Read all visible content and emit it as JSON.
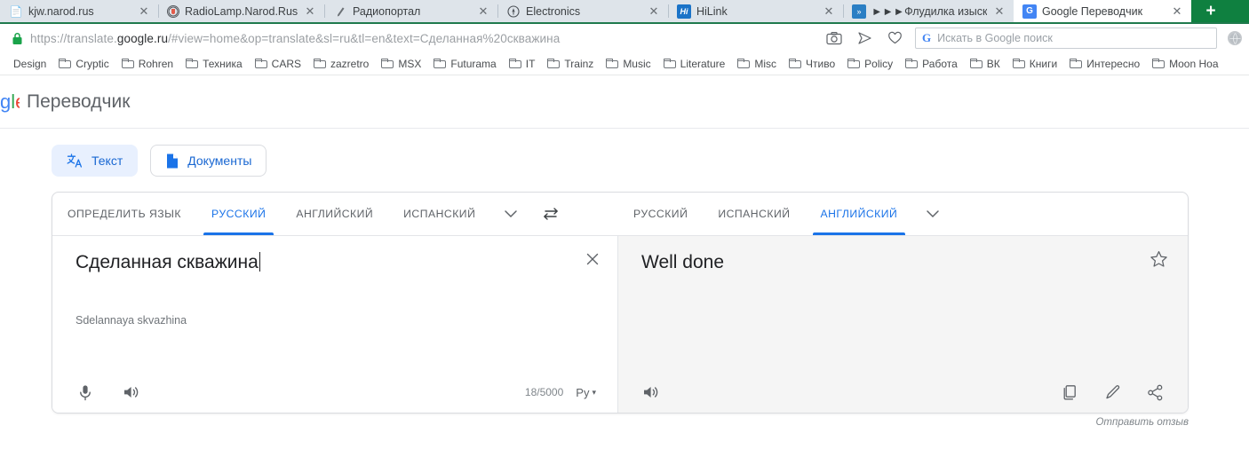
{
  "browser": {
    "tabs": [
      {
        "title": "kjw.narod.rus",
        "favicon": "blank-icon",
        "active": false
      },
      {
        "title": "RadioLamp.Narod.Rus - «Б",
        "favicon": "radiolamp-icon",
        "active": false
      },
      {
        "title": "Радиопортал",
        "favicon": "pen-icon",
        "active": false
      },
      {
        "title": "Electronics",
        "favicon": "electronics-icon",
        "active": false
      },
      {
        "title": "HiLink",
        "favicon": "hilink-icon",
        "active": false
      },
      {
        "title": "►►►Флудилка изысканн",
        "favicon": "forum-icon",
        "active": false
      },
      {
        "title": "Google Переводчик",
        "favicon": "google-translate-icon",
        "active": true
      }
    ],
    "new_tab_label": "+",
    "close_label": "✕",
    "omnibox": {
      "url_prefix": "https://translate.",
      "url_domain": "google.ru",
      "url_suffix": "/#view=home&op=translate&sl=ru&tl=en&text=Сделанная%20скважина",
      "lock_icon": "lock-icon",
      "actions": [
        "camera-icon",
        "send-icon",
        "heart-icon"
      ]
    },
    "search": {
      "placeholder": "Искать в Google поиск",
      "engine_icon": "google-g-icon"
    },
    "bookmarks": [
      {
        "label": "Design",
        "icon": "folder-icon"
      },
      {
        "label": "Cryptic",
        "icon": "folder-icon"
      },
      {
        "label": "Rohren",
        "icon": "folder-icon"
      },
      {
        "label": "Техника",
        "icon": "folder-icon"
      },
      {
        "label": "CARS",
        "icon": "folder-icon"
      },
      {
        "label": "zazretro",
        "icon": "folder-icon"
      },
      {
        "label": "MSX",
        "icon": "folder-icon"
      },
      {
        "label": "Futurama",
        "icon": "folder-icon"
      },
      {
        "label": "IT",
        "icon": "folder-icon"
      },
      {
        "label": "Trainz",
        "icon": "folder-icon"
      },
      {
        "label": "Music",
        "icon": "folder-icon"
      },
      {
        "label": "Literature",
        "icon": "folder-icon"
      },
      {
        "label": "Misc",
        "icon": "folder-icon"
      },
      {
        "label": "Чтиво",
        "icon": "folder-icon"
      },
      {
        "label": "Policy",
        "icon": "folder-icon"
      },
      {
        "label": "Работа",
        "icon": "folder-icon"
      },
      {
        "label": "ВК",
        "icon": "folder-icon"
      },
      {
        "label": "Книги",
        "icon": "folder-icon"
      },
      {
        "label": "Интересно",
        "icon": "folder-icon"
      },
      {
        "label": "Moon Hoa",
        "icon": "folder-icon"
      }
    ]
  },
  "app": {
    "logo_letters": [
      "g",
      "l",
      "e"
    ],
    "title": "Переводчик",
    "modes": [
      {
        "label": "Текст",
        "icon": "translate-text-icon",
        "active": true
      },
      {
        "label": "Документы",
        "icon": "document-icon",
        "active": false
      }
    ],
    "source": {
      "tabs": [
        {
          "label": "ОПРЕДЕЛИТЬ ЯЗЫК",
          "selected": false
        },
        {
          "label": "РУССКИЙ",
          "selected": true
        },
        {
          "label": "АНГЛИЙСКИЙ",
          "selected": false
        },
        {
          "label": "ИСПАНСКИЙ",
          "selected": false
        }
      ],
      "more_icon": "chevron-down-icon",
      "text": "Сделанная скважина",
      "transliteration": "Sdelannaya skvazhina",
      "clear_icon": "close-icon",
      "mic_icon": "microphone-icon",
      "listen_icon": "speaker-icon",
      "char_count": "18/5000",
      "keyboard_language": "Ру",
      "keyboard_caret": "▾"
    },
    "swap_icon": "swap-languages-icon",
    "target": {
      "tabs": [
        {
          "label": "РУССКИЙ",
          "selected": false
        },
        {
          "label": "ИСПАНСКИЙ",
          "selected": false
        },
        {
          "label": "АНГЛИЙСКИЙ",
          "selected": true
        }
      ],
      "more_icon": "chevron-down-icon",
      "text": "Well done",
      "star_icon": "star-outline-icon",
      "listen_icon": "speaker-icon",
      "copy_icon": "copy-icon",
      "edit_icon": "pencil-icon",
      "share_icon": "share-icon"
    },
    "feedback_label": "Отправить отзыв",
    "colors": {
      "accent": "#1a73e8",
      "chrome_green": "#0f8040",
      "tabstrip": "#dee4ea",
      "output_bg": "#f5f5f5"
    }
  }
}
